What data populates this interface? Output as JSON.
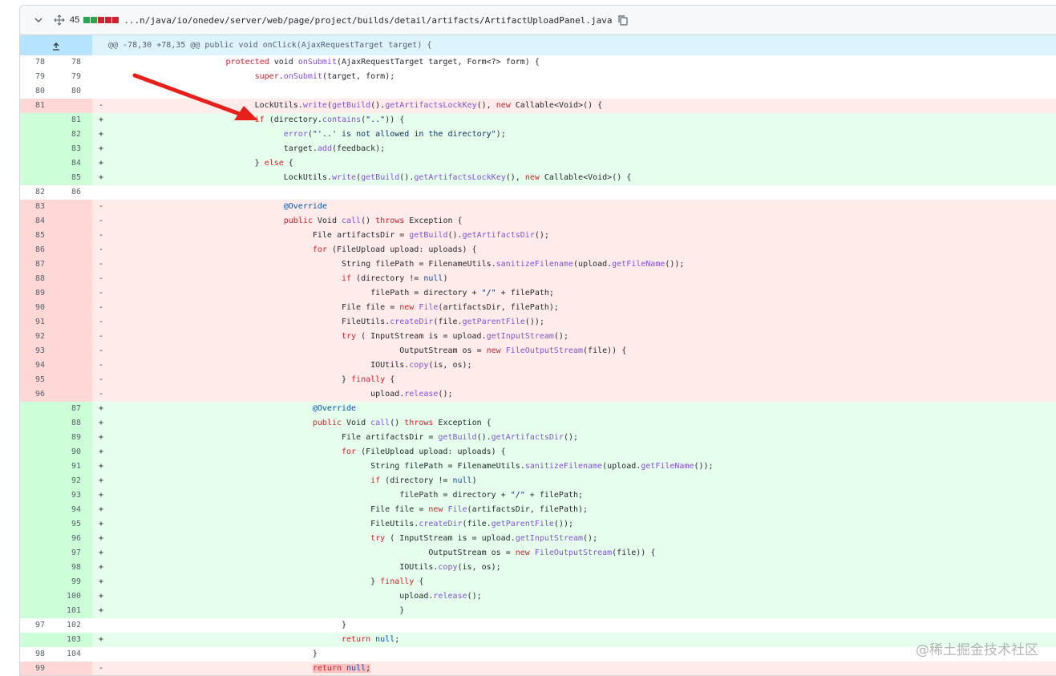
{
  "file": {
    "change_count": "45",
    "path": "...n/java/io/onedev/server/web/page/project/builds/detail/artifacts/ArtifactUploadPanel.java",
    "diffstat_colors": [
      "#2da44e",
      "#2da44e",
      "#cf222e",
      "#cf222e",
      "#cf222e"
    ]
  },
  "hunk": {
    "header": "@@ -78,30 +78,35 @@ public void onClick(AjaxRequestTarget target) {"
  },
  "lines": [
    {
      "t": "ctx",
      "o": "78",
      "n": "78",
      "s": "",
      "html": "\t\t\t\t<span class=\"kw\">protected</span> void <span class=\"fn\">onSubmit</span>(AjaxRequestTarget target, Form&lt;?&gt; form) {"
    },
    {
      "t": "ctx",
      "o": "79",
      "n": "79",
      "s": "",
      "html": "\t\t\t\t\t<span class=\"kw\">super</span>.<span class=\"fn\">onSubmit</span>(target, form);"
    },
    {
      "t": "ctx",
      "o": "80",
      "n": "80",
      "s": "",
      "html": ""
    },
    {
      "t": "del",
      "o": "81",
      "n": "",
      "s": "-",
      "html": "\t\t\t\t\tLockUtils.<span class=\"fn\">write</span>(<span class=\"fn\">getBuild</span>().<span class=\"fn\">getArtifactsLockKey</span>(), <span class=\"kw\">new</span> Callable&lt;Void&gt;() {"
    },
    {
      "t": "add",
      "o": "",
      "n": "81",
      "s": "+",
      "html": "\t\t\t\t\t<span class=\"kw\">if</span> (directory.<span class=\"fn\">contains</span>(<span class=\"str\">\"..\"</span>)) {"
    },
    {
      "t": "add",
      "o": "",
      "n": "82",
      "s": "+",
      "html": "\t\t\t\t\t\t<span class=\"fn\">error</span>(<span class=\"str\">\"'..' is not allowed in the directory\"</span>);"
    },
    {
      "t": "add",
      "o": "",
      "n": "83",
      "s": "+",
      "html": "\t\t\t\t\t\ttarget.<span class=\"fn\">add</span>(feedback);"
    },
    {
      "t": "add",
      "o": "",
      "n": "84",
      "s": "+",
      "html": "\t\t\t\t\t} <span class=\"kw\">else</span> {"
    },
    {
      "t": "add",
      "o": "",
      "n": "85",
      "s": "+",
      "html": "\t\t\t\t\t\tLockUtils.<span class=\"fn\">write</span>(<span class=\"fn\">getBuild</span>().<span class=\"fn\">getArtifactsLockKey</span>(), <span class=\"kw\">new</span> Callable&lt;Void&gt;() {"
    },
    {
      "t": "ctx",
      "o": "82",
      "n": "86",
      "s": "",
      "html": ""
    },
    {
      "t": "del",
      "o": "83",
      "n": "",
      "s": "-",
      "html": "\t\t\t\t\t\t<span class=\"ann\">@Override</span>"
    },
    {
      "t": "del",
      "o": "84",
      "n": "",
      "s": "-",
      "html": "\t\t\t\t\t\t<span class=\"kw\">public</span> Void <span class=\"fn\">call</span>() <span class=\"kw\">throws</span> Exception {"
    },
    {
      "t": "del",
      "o": "85",
      "n": "",
      "s": "-",
      "html": "\t\t\t\t\t\t\tFile artifactsDir = <span class=\"fn\">getBuild</span>().<span class=\"fn\">getArtifactsDir</span>();"
    },
    {
      "t": "del",
      "o": "86",
      "n": "",
      "s": "-",
      "html": "\t\t\t\t\t\t\t<span class=\"kw\">for</span> (FileUpload upload: uploads) {"
    },
    {
      "t": "del",
      "o": "87",
      "n": "",
      "s": "-",
      "html": "\t\t\t\t\t\t\t\tString filePath = FilenameUtils.<span class=\"fn\">sanitizeFilename</span>(upload.<span class=\"fn\">getFileName</span>());"
    },
    {
      "t": "del",
      "o": "88",
      "n": "",
      "s": "-",
      "html": "\t\t\t\t\t\t\t\t<span class=\"kw\">if</span> (directory != <span class=\"ann\">null</span>)"
    },
    {
      "t": "del",
      "o": "89",
      "n": "",
      "s": "-",
      "html": "\t\t\t\t\t\t\t\t\tfilePath = directory + <span class=\"str\">\"/\"</span> + filePath;"
    },
    {
      "t": "del",
      "o": "90",
      "n": "",
      "s": "-",
      "html": "\t\t\t\t\t\t\t\tFile file = <span class=\"kw\">new</span> <span class=\"fn\">File</span>(artifactsDir, filePath);"
    },
    {
      "t": "del",
      "o": "91",
      "n": "",
      "s": "-",
      "html": "\t\t\t\t\t\t\t\tFileUtils.<span class=\"fn\">createDir</span>(file.<span class=\"fn\">getParentFile</span>());"
    },
    {
      "t": "del",
      "o": "92",
      "n": "",
      "s": "-",
      "html": "\t\t\t\t\t\t\t\t<span class=\"kw\">try</span> (\tInputStream is = upload.<span class=\"fn\">getInputStream</span>();"
    },
    {
      "t": "del",
      "o": "93",
      "n": "",
      "s": "-",
      "html": "\t\t\t\t\t\t\t\t\t\tOutputStream os = <span class=\"kw\">new</span> <span class=\"fn\">FileOutputStream</span>(file)) {"
    },
    {
      "t": "del",
      "o": "94",
      "n": "",
      "s": "-",
      "html": "\t\t\t\t\t\t\t\t\tIOUtils.<span class=\"fn\">copy</span>(is, os);"
    },
    {
      "t": "del",
      "o": "95",
      "n": "",
      "s": "-",
      "html": "\t\t\t\t\t\t\t\t} <span class=\"kw\">finally</span> {"
    },
    {
      "t": "del",
      "o": "96",
      "n": "",
      "s": "-",
      "html": "\t\t\t\t\t\t\t\t\tupload.<span class=\"fn\">release</span>();"
    },
    {
      "t": "add",
      "o": "",
      "n": "87",
      "s": "+",
      "html": "\t\t\t\t\t\t\t<span class=\"ann\">@Override</span>"
    },
    {
      "t": "add",
      "o": "",
      "n": "88",
      "s": "+",
      "html": "\t\t\t\t\t\t\t<span class=\"kw\">public</span> Void <span class=\"fn\">call</span>() <span class=\"kw\">throws</span> Exception {"
    },
    {
      "t": "add",
      "o": "",
      "n": "89",
      "s": "+",
      "html": "\t\t\t\t\t\t\t\tFile artifactsDir = <span class=\"fn\">getBuild</span>().<span class=\"fn\">getArtifactsDir</span>();"
    },
    {
      "t": "add",
      "o": "",
      "n": "90",
      "s": "+",
      "html": "\t\t\t\t\t\t\t\t<span class=\"kw\">for</span> (FileUpload upload: uploads) {"
    },
    {
      "t": "add",
      "o": "",
      "n": "91",
      "s": "+",
      "html": "\t\t\t\t\t\t\t\t\tString filePath = FilenameUtils.<span class=\"fn\">sanitizeFilename</span>(upload.<span class=\"fn\">getFileName</span>());"
    },
    {
      "t": "add",
      "o": "",
      "n": "92",
      "s": "+",
      "html": "\t\t\t\t\t\t\t\t\t<span class=\"kw\">if</span> (directory != <span class=\"ann\">null</span>)"
    },
    {
      "t": "add",
      "o": "",
      "n": "93",
      "s": "+",
      "html": "\t\t\t\t\t\t\t\t\t\tfilePath = directory + <span class=\"str\">\"/\"</span> + filePath;"
    },
    {
      "t": "add",
      "o": "",
      "n": "94",
      "s": "+",
      "html": "\t\t\t\t\t\t\t\t\tFile file = <span class=\"kw\">new</span> <span class=\"fn\">File</span>(artifactsDir, filePath);"
    },
    {
      "t": "add",
      "o": "",
      "n": "95",
      "s": "+",
      "html": "\t\t\t\t\t\t\t\t\tFileUtils.<span class=\"fn\">createDir</span>(file.<span class=\"fn\">getParentFile</span>());"
    },
    {
      "t": "add",
      "o": "",
      "n": "96",
      "s": "+",
      "html": "\t\t\t\t\t\t\t\t\t<span class=\"kw\">try</span> (\tInputStream is = upload.<span class=\"fn\">getInputStream</span>();"
    },
    {
      "t": "add",
      "o": "",
      "n": "97",
      "s": "+",
      "html": "\t\t\t\t\t\t\t\t\t\t\tOutputStream os = <span class=\"kw\">new</span> <span class=\"fn\">FileOutputStream</span>(file)) {"
    },
    {
      "t": "add",
      "o": "",
      "n": "98",
      "s": "+",
      "html": "\t\t\t\t\t\t\t\t\t\tIOUtils.<span class=\"fn\">copy</span>(is, os);"
    },
    {
      "t": "add",
      "o": "",
      "n": "99",
      "s": "+",
      "html": "\t\t\t\t\t\t\t\t\t} <span class=\"kw\">finally</span> {"
    },
    {
      "t": "add",
      "o": "",
      "n": "100",
      "s": "+",
      "html": "\t\t\t\t\t\t\t\t\t\tupload.<span class=\"fn\">release</span>();"
    },
    {
      "t": "add",
      "o": "",
      "n": "101",
      "s": "+",
      "html": "\t\t\t\t\t\t\t\t\t\t}"
    },
    {
      "t": "ctx",
      "o": "97",
      "n": "102",
      "s": "",
      "html": "\t\t\t\t\t\t\t\t}"
    },
    {
      "t": "add",
      "o": "",
      "n": "103",
      "s": "+",
      "html": "\t\t\t\t\t\t\t\t<span class=\"kw\">return</span> <span class=\"ann\">null</span>;"
    },
    {
      "t": "ctx",
      "o": "98",
      "n": "104",
      "s": "",
      "html": "\t\t\t\t\t\t\t}"
    },
    {
      "t": "del",
      "o": "99",
      "n": "",
      "s": "-",
      "html": "\t\t\t\t\t\t\t<span class=\"hl-del\"><span class=\"kw\">return</span> <span class=\"ann\">null</span>;</span>"
    }
  ],
  "watermark": "@稀土掘金技术社区"
}
